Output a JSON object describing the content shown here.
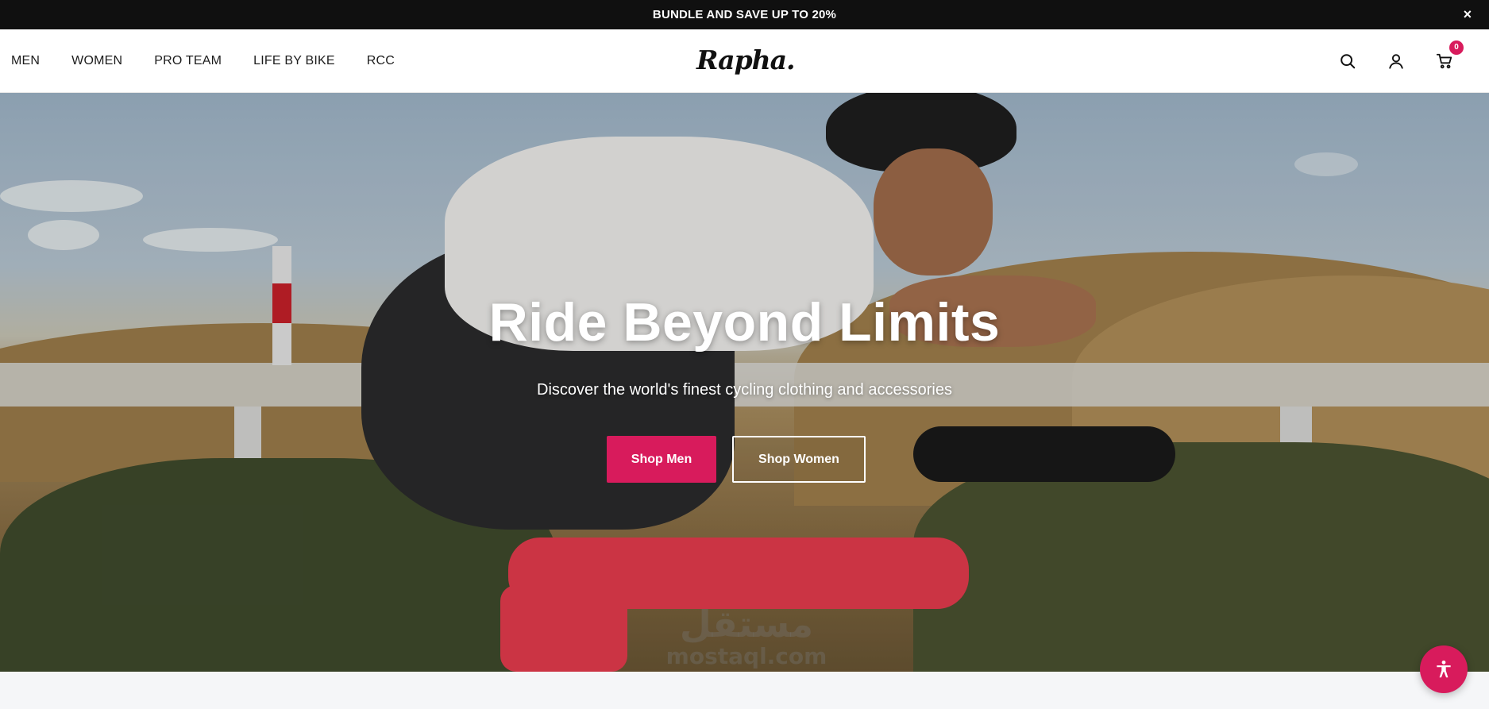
{
  "announcement": {
    "text": "BUNDLE AND SAVE UP TO 20%",
    "close_label": "×"
  },
  "header": {
    "nav": [
      "MEN",
      "WOMEN",
      "PRO TEAM",
      "LIFE BY BIKE",
      "RCC"
    ],
    "logo_text": "Rapha.",
    "icons": [
      "search-icon",
      "account-icon",
      "cart-icon"
    ],
    "cart_count": "0"
  },
  "hero": {
    "title": "Ride Beyond Limits",
    "subtitle": "Discover the world's finest cycling clothing and accessories",
    "primary_button": "Shop Men",
    "secondary_button": "Shop Women"
  },
  "watermark": {
    "arabic": "مستقل",
    "latin": "mostaql.com"
  },
  "colors": {
    "accent": "#d81b5c",
    "announcement_bg": "#101010"
  },
  "accessibility_button_icon": "accessibility-icon"
}
